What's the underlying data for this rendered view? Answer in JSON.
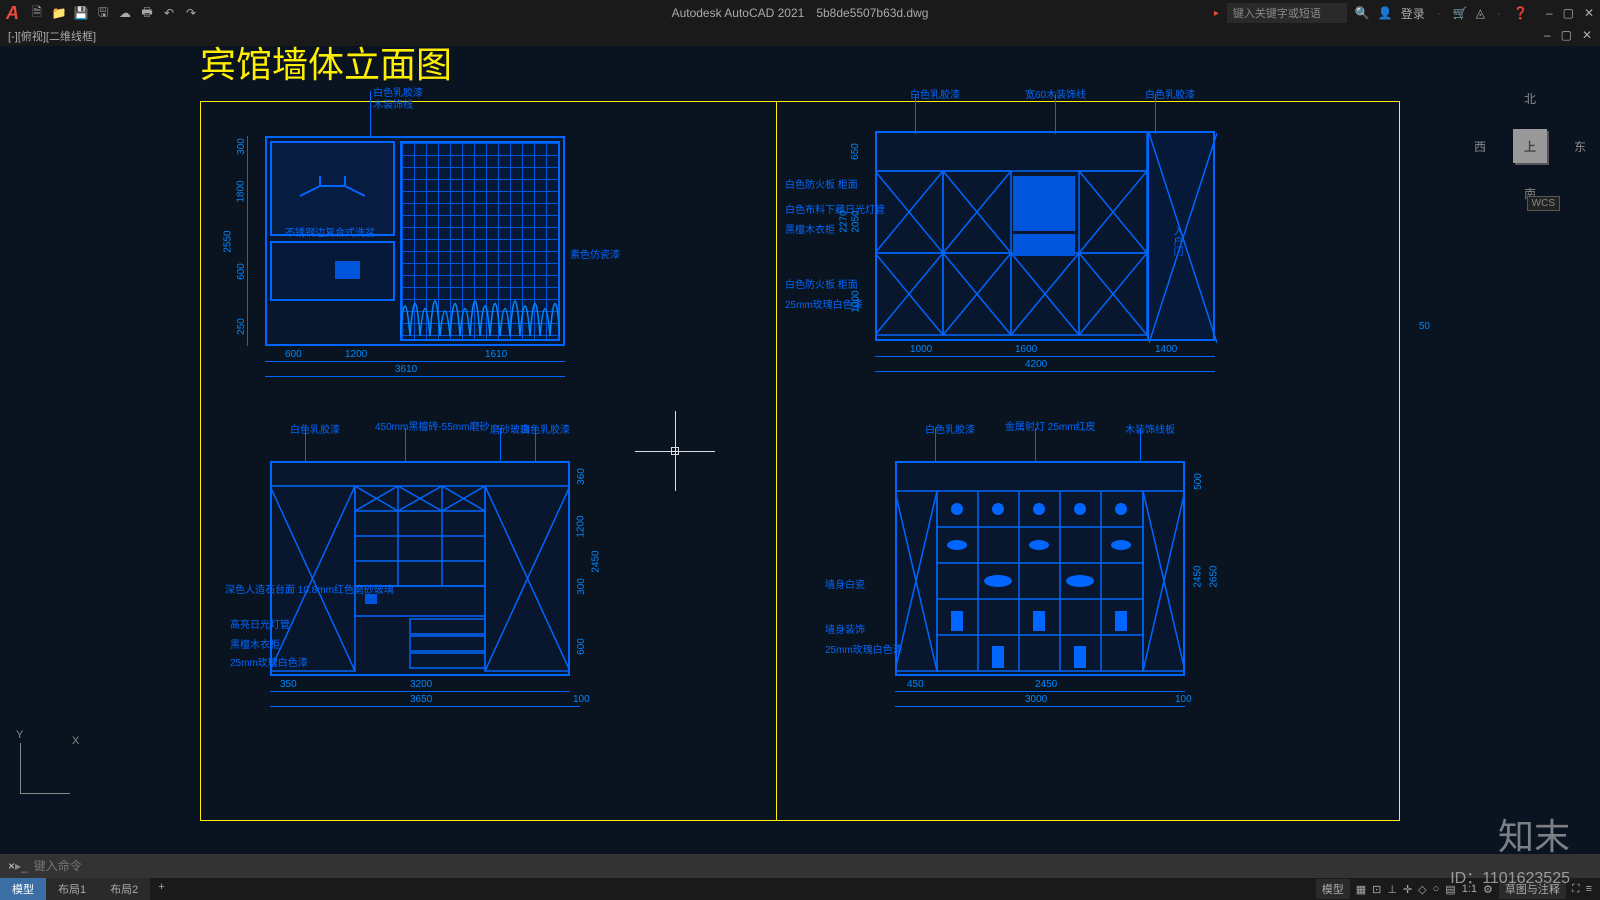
{
  "app": {
    "name": "Autodesk AutoCAD 2021",
    "file": "5b8de5507b63d.dwg"
  },
  "search": {
    "placeholder": "键入关键字或短语",
    "login": "登录"
  },
  "viewtab": {
    "left": "[-][俯视][二维线框]"
  },
  "drawing_title": "宾馆墙体立面图",
  "viewcube": {
    "face": "上",
    "n": "北",
    "s": "南",
    "e": "东",
    "w": "西"
  },
  "wcs": "WCS",
  "coord_50": "50",
  "elevations": {
    "e1": {
      "labels": {
        "top1": "白色乳胶漆",
        "top2": "木装饰线",
        "mid": "不锈钢边复合式洗盆",
        "side": "素色仿瓷漆"
      },
      "dims_h": [
        "600",
        "1200",
        "1610",
        "3610"
      ],
      "dims_v": [
        "300",
        "1800",
        "600",
        "250",
        "2550"
      ]
    },
    "e2": {
      "labels": {
        "top1": "白色乳胶漆",
        "top2": "宽60木装饰线",
        "top3": "白色乳胶漆",
        "l1": "白色防火板 柜面",
        "l2": "白色布料下藏日光灯管",
        "l3": "黑檀木衣柜",
        "l4": "白色防火板 柜面",
        "l5": "25mm玫瑰白色漆",
        "door": "入户门"
      },
      "dims_h": [
        "1000",
        "1600",
        "1400",
        "4200"
      ],
      "dims_v": [
        "650",
        "2050",
        "2270",
        "1000"
      ]
    },
    "e3": {
      "labels": {
        "top1": "白色乳胶漆",
        "top2": "450mm黑檀砖-55mm磨砂",
        "top3": "磨砂玻璃",
        "top4": "白色乳胶漆",
        "l1": "深色人造石台面 10.8mm红色磨砂玻璃",
        "l2": "高亮日光灯管",
        "l3": "黑檀木衣柜",
        "l4": "25mm玫瑰白色漆"
      },
      "dims_h": [
        "350",
        "3200",
        "3650",
        "100"
      ],
      "dims_v": [
        "360",
        "1200",
        "300",
        "2450",
        "600"
      ]
    },
    "e4": {
      "labels": {
        "top1": "白色乳胶漆",
        "top2": "金属射灯 25mm红皮",
        "top3": "木装饰线板",
        "l1": "墙身白瓷",
        "l2": "墙身装饰",
        "l3": "25mm玫瑰白色漆"
      },
      "dims_h": [
        "450",
        "2450",
        "100",
        "3000"
      ],
      "dims_v": [
        "500",
        "2450",
        "2650"
      ]
    }
  },
  "ucs": {
    "x": "X",
    "y": "Y"
  },
  "cmdline": {
    "placeholder": "键入命令",
    "hist": "×"
  },
  "statusbar": {
    "tabs": [
      "模型",
      "布局1",
      "布局2"
    ],
    "plus": "+",
    "right": {
      "model": "模型",
      "scale": "1:1",
      "anno": "草图与注释"
    }
  },
  "watermark": "知末",
  "id": "ID：1101623525",
  "icons": {
    "new": "🗎",
    "open": "📁",
    "save": "💾",
    "saveas": "🖫",
    "cloud": "☁",
    "plot": "🖶",
    "undo": "↶",
    "redo": "↷",
    "search": "🔍",
    "user": "👤",
    "cart": "🛒",
    "share": "◬",
    "help": "❓",
    "min": "–",
    "max": "▢",
    "close": "✕",
    "grid": "▦",
    "snap": "⊡",
    "ortho": "⊥",
    "polar": "✛",
    "iso": "◇",
    "osnap": "○",
    "anno": "▤",
    "gear": "⚙",
    "full": "⛶",
    "menu": "≡"
  }
}
